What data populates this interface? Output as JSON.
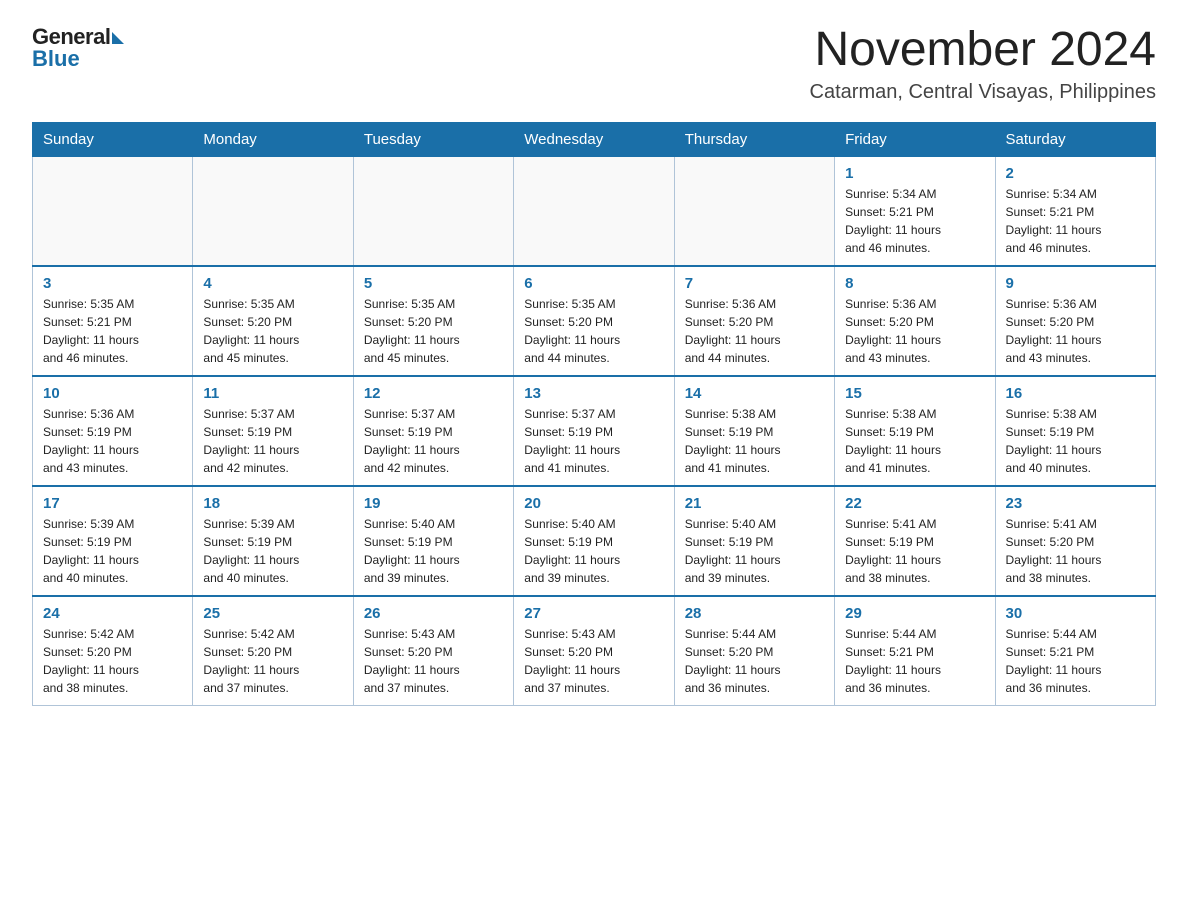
{
  "header": {
    "logo_general": "General",
    "logo_blue": "Blue",
    "month_year": "November 2024",
    "location": "Catarman, Central Visayas, Philippines"
  },
  "weekdays": [
    "Sunday",
    "Monday",
    "Tuesday",
    "Wednesday",
    "Thursday",
    "Friday",
    "Saturday"
  ],
  "weeks": [
    [
      {
        "day": "",
        "info": ""
      },
      {
        "day": "",
        "info": ""
      },
      {
        "day": "",
        "info": ""
      },
      {
        "day": "",
        "info": ""
      },
      {
        "day": "",
        "info": ""
      },
      {
        "day": "1",
        "info": "Sunrise: 5:34 AM\nSunset: 5:21 PM\nDaylight: 11 hours\nand 46 minutes."
      },
      {
        "day": "2",
        "info": "Sunrise: 5:34 AM\nSunset: 5:21 PM\nDaylight: 11 hours\nand 46 minutes."
      }
    ],
    [
      {
        "day": "3",
        "info": "Sunrise: 5:35 AM\nSunset: 5:21 PM\nDaylight: 11 hours\nand 46 minutes."
      },
      {
        "day": "4",
        "info": "Sunrise: 5:35 AM\nSunset: 5:20 PM\nDaylight: 11 hours\nand 45 minutes."
      },
      {
        "day": "5",
        "info": "Sunrise: 5:35 AM\nSunset: 5:20 PM\nDaylight: 11 hours\nand 45 minutes."
      },
      {
        "day": "6",
        "info": "Sunrise: 5:35 AM\nSunset: 5:20 PM\nDaylight: 11 hours\nand 44 minutes."
      },
      {
        "day": "7",
        "info": "Sunrise: 5:36 AM\nSunset: 5:20 PM\nDaylight: 11 hours\nand 44 minutes."
      },
      {
        "day": "8",
        "info": "Sunrise: 5:36 AM\nSunset: 5:20 PM\nDaylight: 11 hours\nand 43 minutes."
      },
      {
        "day": "9",
        "info": "Sunrise: 5:36 AM\nSunset: 5:20 PM\nDaylight: 11 hours\nand 43 minutes."
      }
    ],
    [
      {
        "day": "10",
        "info": "Sunrise: 5:36 AM\nSunset: 5:19 PM\nDaylight: 11 hours\nand 43 minutes."
      },
      {
        "day": "11",
        "info": "Sunrise: 5:37 AM\nSunset: 5:19 PM\nDaylight: 11 hours\nand 42 minutes."
      },
      {
        "day": "12",
        "info": "Sunrise: 5:37 AM\nSunset: 5:19 PM\nDaylight: 11 hours\nand 42 minutes."
      },
      {
        "day": "13",
        "info": "Sunrise: 5:37 AM\nSunset: 5:19 PM\nDaylight: 11 hours\nand 41 minutes."
      },
      {
        "day": "14",
        "info": "Sunrise: 5:38 AM\nSunset: 5:19 PM\nDaylight: 11 hours\nand 41 minutes."
      },
      {
        "day": "15",
        "info": "Sunrise: 5:38 AM\nSunset: 5:19 PM\nDaylight: 11 hours\nand 41 minutes."
      },
      {
        "day": "16",
        "info": "Sunrise: 5:38 AM\nSunset: 5:19 PM\nDaylight: 11 hours\nand 40 minutes."
      }
    ],
    [
      {
        "day": "17",
        "info": "Sunrise: 5:39 AM\nSunset: 5:19 PM\nDaylight: 11 hours\nand 40 minutes."
      },
      {
        "day": "18",
        "info": "Sunrise: 5:39 AM\nSunset: 5:19 PM\nDaylight: 11 hours\nand 40 minutes."
      },
      {
        "day": "19",
        "info": "Sunrise: 5:40 AM\nSunset: 5:19 PM\nDaylight: 11 hours\nand 39 minutes."
      },
      {
        "day": "20",
        "info": "Sunrise: 5:40 AM\nSunset: 5:19 PM\nDaylight: 11 hours\nand 39 minutes."
      },
      {
        "day": "21",
        "info": "Sunrise: 5:40 AM\nSunset: 5:19 PM\nDaylight: 11 hours\nand 39 minutes."
      },
      {
        "day": "22",
        "info": "Sunrise: 5:41 AM\nSunset: 5:19 PM\nDaylight: 11 hours\nand 38 minutes."
      },
      {
        "day": "23",
        "info": "Sunrise: 5:41 AM\nSunset: 5:20 PM\nDaylight: 11 hours\nand 38 minutes."
      }
    ],
    [
      {
        "day": "24",
        "info": "Sunrise: 5:42 AM\nSunset: 5:20 PM\nDaylight: 11 hours\nand 38 minutes."
      },
      {
        "day": "25",
        "info": "Sunrise: 5:42 AM\nSunset: 5:20 PM\nDaylight: 11 hours\nand 37 minutes."
      },
      {
        "day": "26",
        "info": "Sunrise: 5:43 AM\nSunset: 5:20 PM\nDaylight: 11 hours\nand 37 minutes."
      },
      {
        "day": "27",
        "info": "Sunrise: 5:43 AM\nSunset: 5:20 PM\nDaylight: 11 hours\nand 37 minutes."
      },
      {
        "day": "28",
        "info": "Sunrise: 5:44 AM\nSunset: 5:20 PM\nDaylight: 11 hours\nand 36 minutes."
      },
      {
        "day": "29",
        "info": "Sunrise: 5:44 AM\nSunset: 5:21 PM\nDaylight: 11 hours\nand 36 minutes."
      },
      {
        "day": "30",
        "info": "Sunrise: 5:44 AM\nSunset: 5:21 PM\nDaylight: 11 hours\nand 36 minutes."
      }
    ]
  ]
}
